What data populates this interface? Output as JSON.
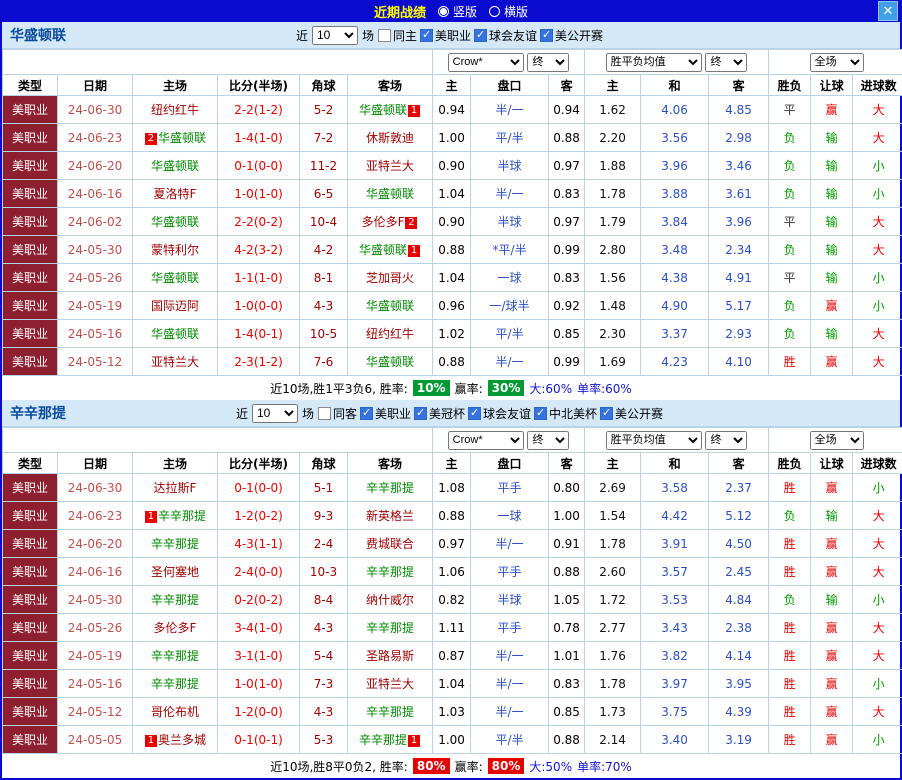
{
  "titlebar": {
    "title": "近期战绩",
    "layout_vertical": "竖版",
    "layout_horizontal": "横版",
    "close_label": "✕"
  },
  "filter_labels": {
    "near": "近",
    "games": "场"
  },
  "filter_row": {
    "bookmaker": "Crow*",
    "asian_final": "终",
    "euro_label": "胜平负均值",
    "euro_final": "终",
    "scope": "全场"
  },
  "columns": [
    "类型",
    "日期",
    "主场",
    "比分(半场)",
    "角球",
    "客场",
    "主",
    "盘口",
    "客",
    "主",
    "和",
    "客",
    "胜负",
    "让球",
    "进球数"
  ],
  "value_colors": {
    "胜": "#e60000",
    "平": "#333333",
    "负": "#009900",
    "赢": "#e60000",
    "输": "#009900",
    "大": "#e60000",
    "小": "#009900"
  },
  "sections": [
    {
      "team": "华盛顿联",
      "games_count": "10",
      "checkboxes": [
        {
          "label": "同主",
          "checked": false
        },
        {
          "label": "美职业",
          "checked": true
        },
        {
          "label": "球会友谊",
          "checked": true
        },
        {
          "label": "美公开赛",
          "checked": true
        }
      ],
      "rows": [
        {
          "league": "美职业",
          "date": "24-06-30",
          "home": {
            "name": "纽约红牛",
            "focus": false
          },
          "score": "2-2(1-2)",
          "corner": "5-2",
          "away": {
            "name": "华盛顿联",
            "post": "1",
            "focus": true
          },
          "ah": [
            "0.94",
            "半/一",
            "0.94"
          ],
          "odds": [
            "1.62",
            "4.06",
            "4.85"
          ],
          "results": [
            "平",
            "赢",
            "大"
          ]
        },
        {
          "league": "美职业",
          "date": "24-06-23",
          "home": {
            "pre": "2",
            "name": "华盛顿联",
            "focus": true
          },
          "score": "1-4(1-0)",
          "corner": "7-2",
          "away": {
            "name": "休斯敦迪",
            "focus": false
          },
          "ah": [
            "1.00",
            "平/半",
            "0.88"
          ],
          "odds": [
            "2.20",
            "3.56",
            "2.98"
          ],
          "results": [
            "负",
            "输",
            "大"
          ]
        },
        {
          "league": "美职业",
          "date": "24-06-20",
          "home": {
            "name": "华盛顿联",
            "focus": true
          },
          "score": "0-1(0-0)",
          "corner": "11-2",
          "away": {
            "name": "亚特兰大",
            "focus": false
          },
          "ah": [
            "0.90",
            "半球",
            "0.97"
          ],
          "odds": [
            "1.88",
            "3.96",
            "3.46"
          ],
          "results": [
            "负",
            "输",
            "小"
          ]
        },
        {
          "league": "美职业",
          "date": "24-06-16",
          "home": {
            "name": "夏洛特F",
            "focus": false
          },
          "score": "1-0(1-0)",
          "corner": "6-5",
          "away": {
            "name": "华盛顿联",
            "focus": true
          },
          "ah": [
            "1.04",
            "半/一",
            "0.83"
          ],
          "odds": [
            "1.78",
            "3.88",
            "3.61"
          ],
          "results": [
            "负",
            "输",
            "小"
          ]
        },
        {
          "league": "美职业",
          "date": "24-06-02",
          "home": {
            "name": "华盛顿联",
            "focus": true
          },
          "score": "2-2(0-2)",
          "corner": "10-4",
          "away": {
            "name": "多伦多F",
            "post": "2",
            "focus": false
          },
          "ah": [
            "0.90",
            "半球",
            "0.97"
          ],
          "odds": [
            "1.79",
            "3.84",
            "3.96"
          ],
          "results": [
            "平",
            "输",
            "大"
          ]
        },
        {
          "league": "美职业",
          "date": "24-05-30",
          "home": {
            "name": "蒙特利尔",
            "focus": false
          },
          "score": "4-2(3-2)",
          "corner": "4-2",
          "away": {
            "name": "华盛顿联",
            "post": "1",
            "focus": true
          },
          "ah": [
            "0.88",
            "*平/半",
            "0.99"
          ],
          "odds": [
            "2.80",
            "3.48",
            "2.34"
          ],
          "results": [
            "负",
            "输",
            "大"
          ]
        },
        {
          "league": "美职业",
          "date": "24-05-26",
          "home": {
            "name": "华盛顿联",
            "focus": true
          },
          "score": "1-1(1-0)",
          "corner": "8-1",
          "away": {
            "name": "芝加哥火",
            "focus": false
          },
          "ah": [
            "1.04",
            "一球",
            "0.83"
          ],
          "odds": [
            "1.56",
            "4.38",
            "4.91"
          ],
          "results": [
            "平",
            "输",
            "小"
          ]
        },
        {
          "league": "美职业",
          "date": "24-05-19",
          "home": {
            "name": "国际迈阿",
            "focus": false
          },
          "score": "1-0(0-0)",
          "corner": "4-3",
          "away": {
            "name": "华盛顿联",
            "focus": true
          },
          "ah": [
            "0.96",
            "一/球半",
            "0.92"
          ],
          "odds": [
            "1.48",
            "4.90",
            "5.17"
          ],
          "results": [
            "负",
            "赢",
            "小"
          ]
        },
        {
          "league": "美职业",
          "date": "24-05-16",
          "home": {
            "name": "华盛顿联",
            "focus": true
          },
          "score": "1-4(0-1)",
          "corner": "10-5",
          "away": {
            "name": "纽约红牛",
            "focus": false
          },
          "ah": [
            "1.02",
            "平/半",
            "0.85"
          ],
          "odds": [
            "2.30",
            "3.37",
            "2.93"
          ],
          "results": [
            "负",
            "输",
            "大"
          ]
        },
        {
          "league": "美职业",
          "date": "24-05-12",
          "home": {
            "name": "亚特兰大",
            "focus": false
          },
          "score": "2-3(1-2)",
          "corner": "7-6",
          "away": {
            "name": "华盛顿联",
            "focus": true
          },
          "ah": [
            "0.88",
            "半/一",
            "0.99"
          ],
          "odds": [
            "1.69",
            "4.23",
            "4.10"
          ],
          "results": [
            "胜",
            "赢",
            "大"
          ]
        }
      ],
      "summary": {
        "prefix": "近10场,胜1平3负6, 胜率:",
        "win_rate": "10%",
        "win_rate_bg": "#009933",
        "mid": "赢率:",
        "profit_rate": "30%",
        "profit_rate_bg": "#009933",
        "big_rate": "大:60%",
        "single_rate": "单率:60%"
      }
    },
    {
      "team": "辛辛那提",
      "games_count": "10",
      "checkboxes": [
        {
          "label": "同客",
          "checked": false
        },
        {
          "label": "美职业",
          "checked": true
        },
        {
          "label": "美冠杯",
          "checked": true
        },
        {
          "label": "球会友谊",
          "checked": true
        },
        {
          "label": "中北美杯",
          "checked": true
        },
        {
          "label": "美公开赛",
          "checked": true
        }
      ],
      "rows": [
        {
          "league": "美职业",
          "date": "24-06-30",
          "home": {
            "name": "达拉斯F",
            "focus": false
          },
          "score": "0-1(0-0)",
          "corner": "5-1",
          "away": {
            "name": "辛辛那提",
            "focus": true
          },
          "ah": [
            "1.08",
            "平手",
            "0.80"
          ],
          "odds": [
            "2.69",
            "3.58",
            "2.37"
          ],
          "results": [
            "胜",
            "赢",
            "小"
          ]
        },
        {
          "league": "美职业",
          "date": "24-06-23",
          "home": {
            "pre": "1",
            "name": "辛辛那提",
            "focus": true
          },
          "score": "1-2(0-2)",
          "corner": "9-3",
          "away": {
            "name": "新英格兰",
            "focus": false
          },
          "ah": [
            "0.88",
            "一球",
            "1.00"
          ],
          "odds": [
            "1.54",
            "4.42",
            "5.12"
          ],
          "results": [
            "负",
            "输",
            "大"
          ]
        },
        {
          "league": "美职业",
          "date": "24-06-20",
          "home": {
            "name": "辛辛那提",
            "focus": true
          },
          "score": "4-3(1-1)",
          "corner": "2-4",
          "away": {
            "name": "费城联合",
            "focus": false
          },
          "ah": [
            "0.97",
            "半/一",
            "0.91"
          ],
          "odds": [
            "1.78",
            "3.91",
            "4.50"
          ],
          "results": [
            "胜",
            "赢",
            "大"
          ]
        },
        {
          "league": "美职业",
          "date": "24-06-16",
          "home": {
            "name": "圣何塞地",
            "focus": false
          },
          "score": "2-4(0-0)",
          "corner": "10-3",
          "away": {
            "name": "辛辛那提",
            "focus": true
          },
          "ah": [
            "1.06",
            "平手",
            "0.88"
          ],
          "odds": [
            "2.60",
            "3.57",
            "2.45"
          ],
          "results": [
            "胜",
            "赢",
            "大"
          ]
        },
        {
          "league": "美职业",
          "date": "24-05-30",
          "home": {
            "name": "辛辛那提",
            "focus": true
          },
          "score": "0-2(0-2)",
          "corner": "8-4",
          "away": {
            "name": "纳什威尔",
            "focus": false
          },
          "ah": [
            "0.82",
            "半球",
            "1.05"
          ],
          "odds": [
            "1.72",
            "3.53",
            "4.84"
          ],
          "results": [
            "负",
            "输",
            "小"
          ]
        },
        {
          "league": "美职业",
          "date": "24-05-26",
          "home": {
            "name": "多伦多F",
            "focus": false
          },
          "score": "3-4(1-0)",
          "corner": "4-3",
          "away": {
            "name": "辛辛那提",
            "focus": true
          },
          "ah": [
            "1.11",
            "平手",
            "0.78"
          ],
          "odds": [
            "2.77",
            "3.43",
            "2.38"
          ],
          "results": [
            "胜",
            "赢",
            "大"
          ]
        },
        {
          "league": "美职业",
          "date": "24-05-19",
          "home": {
            "name": "辛辛那提",
            "focus": true
          },
          "score": "3-1(1-0)",
          "corner": "5-4",
          "away": {
            "name": "圣路易斯",
            "focus": false
          },
          "ah": [
            "0.87",
            "半/一",
            "1.01"
          ],
          "odds": [
            "1.76",
            "3.82",
            "4.14"
          ],
          "results": [
            "胜",
            "赢",
            "大"
          ]
        },
        {
          "league": "美职业",
          "date": "24-05-16",
          "home": {
            "name": "辛辛那提",
            "focus": true
          },
          "score": "1-0(1-0)",
          "corner": "7-3",
          "away": {
            "name": "亚特兰大",
            "focus": false
          },
          "ah": [
            "1.04",
            "半/一",
            "0.83"
          ],
          "odds": [
            "1.78",
            "3.97",
            "3.95"
          ],
          "results": [
            "胜",
            "赢",
            "小"
          ]
        },
        {
          "league": "美职业",
          "date": "24-05-12",
          "home": {
            "name": "哥伦布机",
            "focus": false
          },
          "score": "1-2(0-0)",
          "corner": "4-3",
          "away": {
            "name": "辛辛那提",
            "focus": true
          },
          "ah": [
            "1.03",
            "半/一",
            "0.85"
          ],
          "odds": [
            "1.73",
            "3.75",
            "4.39"
          ],
          "results": [
            "胜",
            "赢",
            "大"
          ]
        },
        {
          "league": "美职业",
          "date": "24-05-05",
          "home": {
            "pre": "1",
            "name": "奥兰多城",
            "focus": false
          },
          "score": "0-1(0-1)",
          "corner": "5-3",
          "away": {
            "name": "辛辛那提",
            "post": "1",
            "focus": true
          },
          "ah": [
            "1.00",
            "平/半",
            "0.88"
          ],
          "odds": [
            "2.14",
            "3.40",
            "3.19"
          ],
          "results": [
            "胜",
            "赢",
            "小"
          ]
        }
      ],
      "summary": {
        "prefix": "近10场,胜8平0负2, 胜率:",
        "win_rate": "80%",
        "win_rate_bg": "#e60000",
        "mid": "赢率:",
        "profit_rate": "80%",
        "profit_rate_bg": "#e60000",
        "big_rate": "大:50%",
        "single_rate": "单率:70%"
      }
    }
  ]
}
